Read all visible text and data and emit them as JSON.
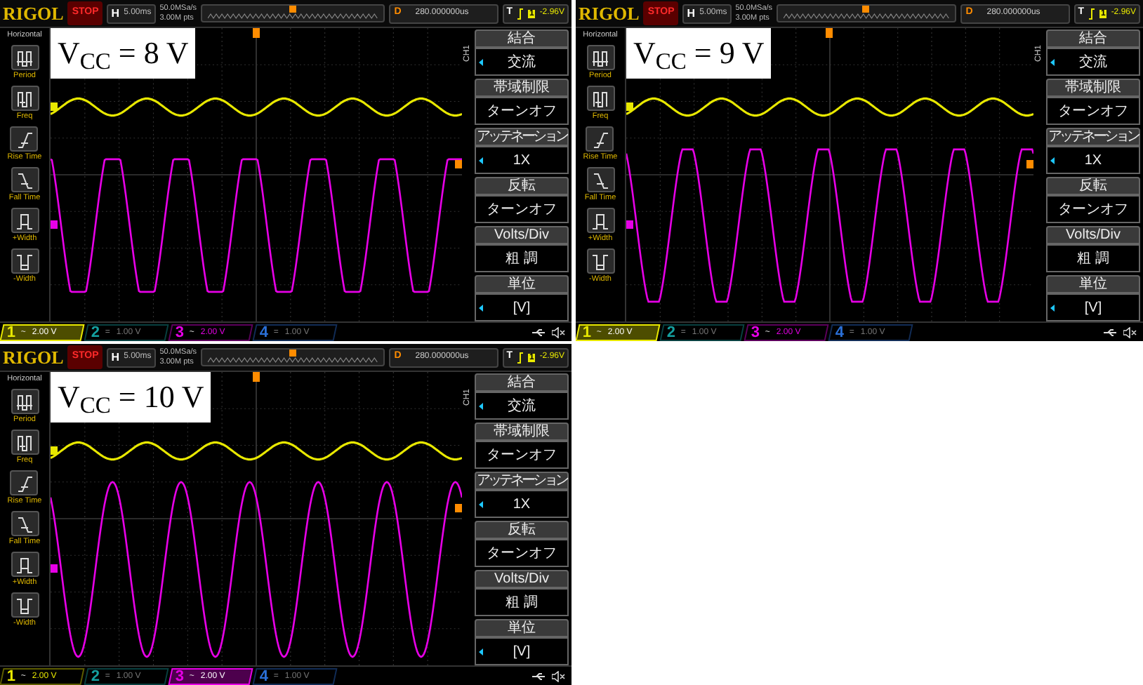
{
  "scopes": [
    {
      "label": "V$_{CC}$ = 8 V",
      "logo": "RIGOL",
      "run_state": "STOP",
      "timebase": {
        "key": "H",
        "value": "5.00ms"
      },
      "sample_rate": "50.0MSa/s",
      "memory_depth": "3.00M pts",
      "delay": {
        "key": "D",
        "value": "280.000000us"
      },
      "trigger": {
        "key": "T",
        "source": "1",
        "level": "-2.96V"
      },
      "sidebar_title": "Horizontal",
      "measurements": [
        "Period",
        "Freq",
        "Rise Time",
        "Fall Time",
        "+Width",
        "-Width"
      ],
      "menu_channel": "CH1",
      "menu": [
        {
          "title": "結合",
          "value": "交流",
          "arrow": true
        },
        {
          "title": "帯域制限",
          "value": "ターンオフ",
          "arrow": false
        },
        {
          "title": "アッテネーション",
          "value": "1X",
          "arrow": true
        },
        {
          "title": "反転",
          "value": "ターンオフ",
          "arrow": false
        },
        {
          "title": "Volts/Div",
          "value": "粗 調",
          "arrow": false
        },
        {
          "title": "単位",
          "value": "[V]",
          "arrow": true
        }
      ],
      "output_trace": {
        "kind": "heavy_clip"
      },
      "channels": [
        {
          "number": "1",
          "coupling": "~",
          "scale": "2.00 V",
          "color": "#e8e800",
          "on": true,
          "selected": true
        },
        {
          "number": "2",
          "coupling": "=",
          "scale": "1.00 V",
          "color": "#14a0a0",
          "on": false,
          "selected": false
        },
        {
          "number": "3",
          "coupling": "~",
          "scale": "2.00 V",
          "color": "#e600e6",
          "on": true,
          "selected": false
        },
        {
          "number": "4",
          "coupling": "=",
          "scale": "1.00 V",
          "color": "#2a6fd6",
          "on": false,
          "selected": false
        }
      ]
    },
    {
      "label": "V$_{CC}$ = 9 V",
      "logo": "RIGOL",
      "run_state": "STOP",
      "timebase": {
        "key": "H",
        "value": "5.00ms"
      },
      "sample_rate": "50.0MSa/s",
      "memory_depth": "3.00M pts",
      "delay": {
        "key": "D",
        "value": "280.000000us"
      },
      "trigger": {
        "key": "T",
        "source": "1",
        "level": "-2.96V"
      },
      "sidebar_title": "Horizontal",
      "measurements": [
        "Period",
        "Freq",
        "Rise Time",
        "Fall Time",
        "+Width",
        "-Width"
      ],
      "menu_channel": "CH1",
      "menu": [
        {
          "title": "結合",
          "value": "交流",
          "arrow": true
        },
        {
          "title": "帯域制限",
          "value": "ターンオフ",
          "arrow": false
        },
        {
          "title": "アッテネーション",
          "value": "1X",
          "arrow": true
        },
        {
          "title": "反転",
          "value": "ターンオフ",
          "arrow": false
        },
        {
          "title": "Volts/Div",
          "value": "粗 調",
          "arrow": false
        },
        {
          "title": "単位",
          "value": "[V]",
          "arrow": true
        }
      ],
      "output_trace": {
        "kind": "mild_clip"
      },
      "channels": [
        {
          "number": "1",
          "coupling": "~",
          "scale": "2.00 V",
          "color": "#e8e800",
          "on": true,
          "selected": true
        },
        {
          "number": "2",
          "coupling": "=",
          "scale": "1.00 V",
          "color": "#14a0a0",
          "on": false,
          "selected": false
        },
        {
          "number": "3",
          "coupling": "~",
          "scale": "2.00 V",
          "color": "#e600e6",
          "on": true,
          "selected": false
        },
        {
          "number": "4",
          "coupling": "=",
          "scale": "1.00 V",
          "color": "#2a6fd6",
          "on": false,
          "selected": false
        }
      ]
    },
    {
      "label": "V$_{CC}$ = 10 V",
      "logo": "RIGOL",
      "run_state": "STOP",
      "timebase": {
        "key": "H",
        "value": "5.00ms"
      },
      "sample_rate": "50.0MSa/s",
      "memory_depth": "3.00M pts",
      "delay": {
        "key": "D",
        "value": "280.000000us"
      },
      "trigger": {
        "key": "T",
        "source": "1",
        "level": "-2.96V"
      },
      "sidebar_title": "Horizontal",
      "measurements": [
        "Period",
        "Freq",
        "Rise Time",
        "Fall Time",
        "+Width",
        "-Width"
      ],
      "menu_channel": "CH1",
      "menu": [
        {
          "title": "結合",
          "value": "交流",
          "arrow": true
        },
        {
          "title": "帯域制限",
          "value": "ターンオフ",
          "arrow": false
        },
        {
          "title": "アッテネーション",
          "value": "1X",
          "arrow": true
        },
        {
          "title": "反転",
          "value": "ターンオフ",
          "arrow": false
        },
        {
          "title": "Volts/Div",
          "value": "粗 調",
          "arrow": false
        },
        {
          "title": "単位",
          "value": "[V]",
          "arrow": true
        }
      ],
      "output_trace": {
        "kind": "no_clip"
      },
      "channels": [
        {
          "number": "1",
          "coupling": "~",
          "scale": "2.00 V",
          "color": "#e8e800",
          "on": true,
          "selected": false
        },
        {
          "number": "2",
          "coupling": "=",
          "scale": "1.00 V",
          "color": "#14a0a0",
          "on": false,
          "selected": false
        },
        {
          "number": "3",
          "coupling": "~",
          "scale": "2.00 V",
          "color": "#e600e6",
          "on": true,
          "selected": true
        },
        {
          "number": "4",
          "coupling": "=",
          "scale": "1.00 V",
          "color": "#2a6fd6",
          "on": false,
          "selected": false
        }
      ]
    }
  ]
}
